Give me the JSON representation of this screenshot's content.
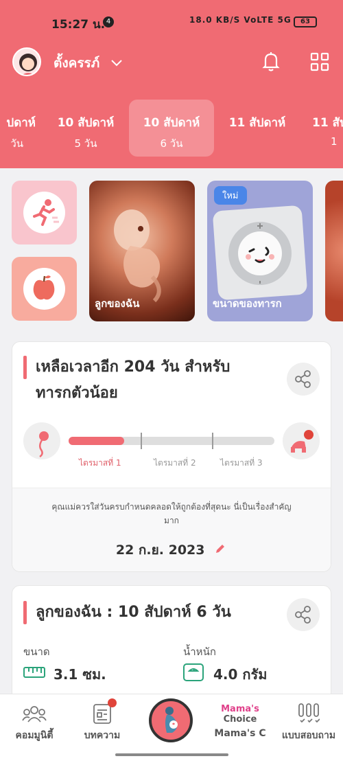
{
  "status_bar": {
    "time": "15:27 น.",
    "notification_count": "4",
    "indicators": "18.0 KB/S VoLTE 5G",
    "battery": "63"
  },
  "header": {
    "profile_name": "ตั้งครรภ์"
  },
  "weeks": [
    {
      "week": "ปดาห์",
      "days": "วัน"
    },
    {
      "week": "10 สัปดาห์",
      "days": "5 วัน"
    },
    {
      "week": "10 สัปดาห์",
      "days": "6 วัน",
      "active": true
    },
    {
      "week": "11 สัปดาห์",
      "days": ""
    },
    {
      "week": "11 สัป",
      "days": "1"
    }
  ],
  "tiles": {
    "baby_label": "ลูกของฉัน",
    "size_label": "ขนาดของทารก",
    "new_badge": "ใหม่"
  },
  "countdown": {
    "title_line1": "เหลือเวลาอีก 204 วัน สำหรับ",
    "title_line2": "ทารกตัวน้อย",
    "progress_fraction": 0.27,
    "trimesters": [
      "ไตรมาสที่ 1",
      "ไตรมาสที่ 2",
      "ไตรมาสที่ 3"
    ],
    "note_line1": "คุณแม่ควรใส่วันครบกำหนดคลอดให้ถูกต้องที่สุดนะ นี่เป็นเรื่องสำคัญ",
    "note_line2": "มาก",
    "due_date": "22 ก.ย. 2023"
  },
  "baby": {
    "title": "ลูกของฉัน : 10 สัปดาห์ 6  วัน",
    "size_label": "ขนาด",
    "size_value": "3.1 ซม.",
    "weight_label": "น้ำหนัก",
    "weight_value": "4.0 กรัม"
  },
  "nav": {
    "community": "คอมมูนิตี้",
    "articles": "บทความ",
    "mamas_choice_logo_1": "Mama's",
    "mamas_choice_logo_2": "Choice",
    "mamas_choice": "Mama's C",
    "quiz": "แบบสอบถาม"
  },
  "colors": {
    "brand": "#f06b73",
    "progress_track": "#dedede",
    "badge_blue": "#4a86e8"
  }
}
